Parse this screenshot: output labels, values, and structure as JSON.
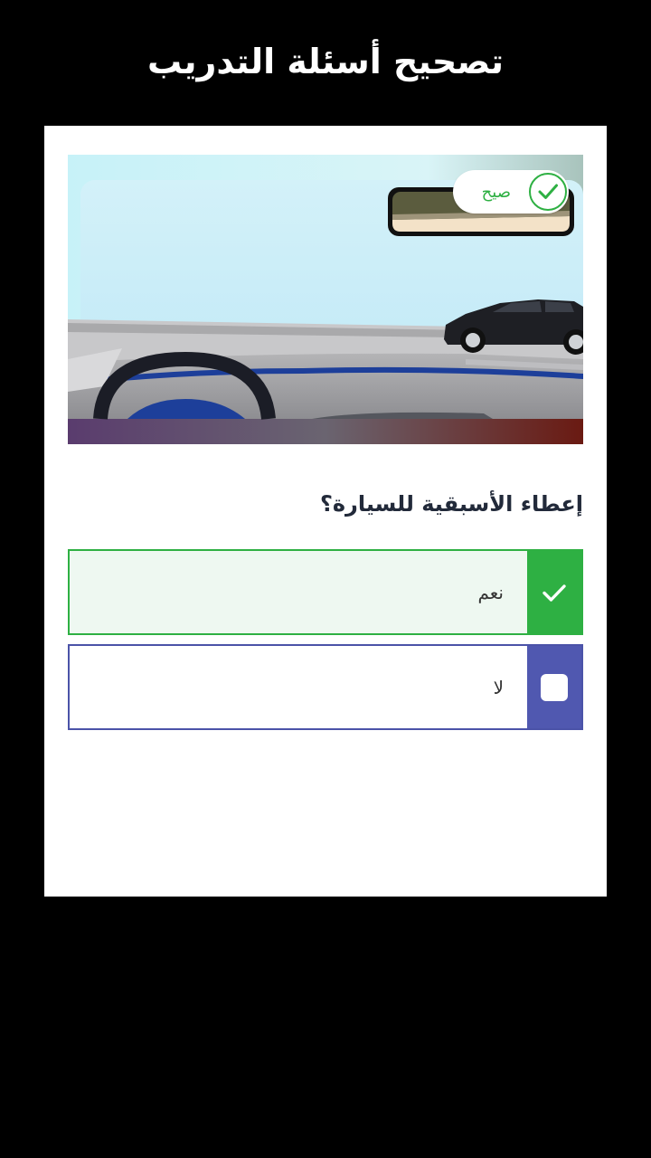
{
  "header": {
    "title": "تصحيح أسئلة التدريب"
  },
  "image": {
    "verdict_label": "صيح",
    "verdict_color": "#2eb043"
  },
  "question": {
    "text": "إعطاء الأسبقية للسيارة؟"
  },
  "options": [
    {
      "label": "نعم",
      "state": "selected-correct",
      "icon": "check-icon"
    },
    {
      "label": "لا",
      "state": "unselected",
      "icon": "empty-checkbox-icon"
    }
  ],
  "colors": {
    "correct": "#2eb043",
    "option_accent": "#5058b0",
    "correct_background": "#eef8f1"
  }
}
